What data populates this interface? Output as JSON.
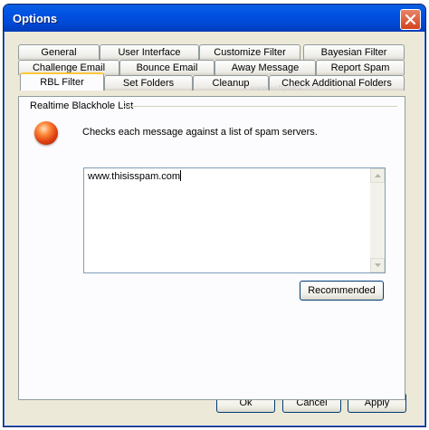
{
  "window": {
    "title": "Options"
  },
  "tabs_row1": [
    {
      "label": "General"
    },
    {
      "label": "User Interface"
    },
    {
      "label": "Customize Filter"
    },
    {
      "label": "Bayesian Filter"
    }
  ],
  "tabs_row2": [
    {
      "label": "Challenge Email"
    },
    {
      "label": "Bounce Email"
    },
    {
      "label": "Away Message"
    },
    {
      "label": "Report Spam"
    }
  ],
  "tabs_row3": [
    {
      "label": "RBL Filter"
    },
    {
      "label": "Set Folders"
    },
    {
      "label": "Cleanup"
    },
    {
      "label": "Check Additional Folders"
    }
  ],
  "watermark": "www.softpedia.com",
  "panel": {
    "group_label": "Realtime Blackhole List",
    "description": "Checks each message against a list of spam servers.",
    "server_list_value": "www.thisisspam.com",
    "recommended_label": "Recommended"
  },
  "buttons": {
    "ok": "Ok",
    "cancel": "Cancel",
    "apply": "Apply"
  },
  "colors": {
    "titlebar": "#0054e3",
    "active_tab_highlight": "#ffc83c",
    "close_button": "#d4431c"
  }
}
